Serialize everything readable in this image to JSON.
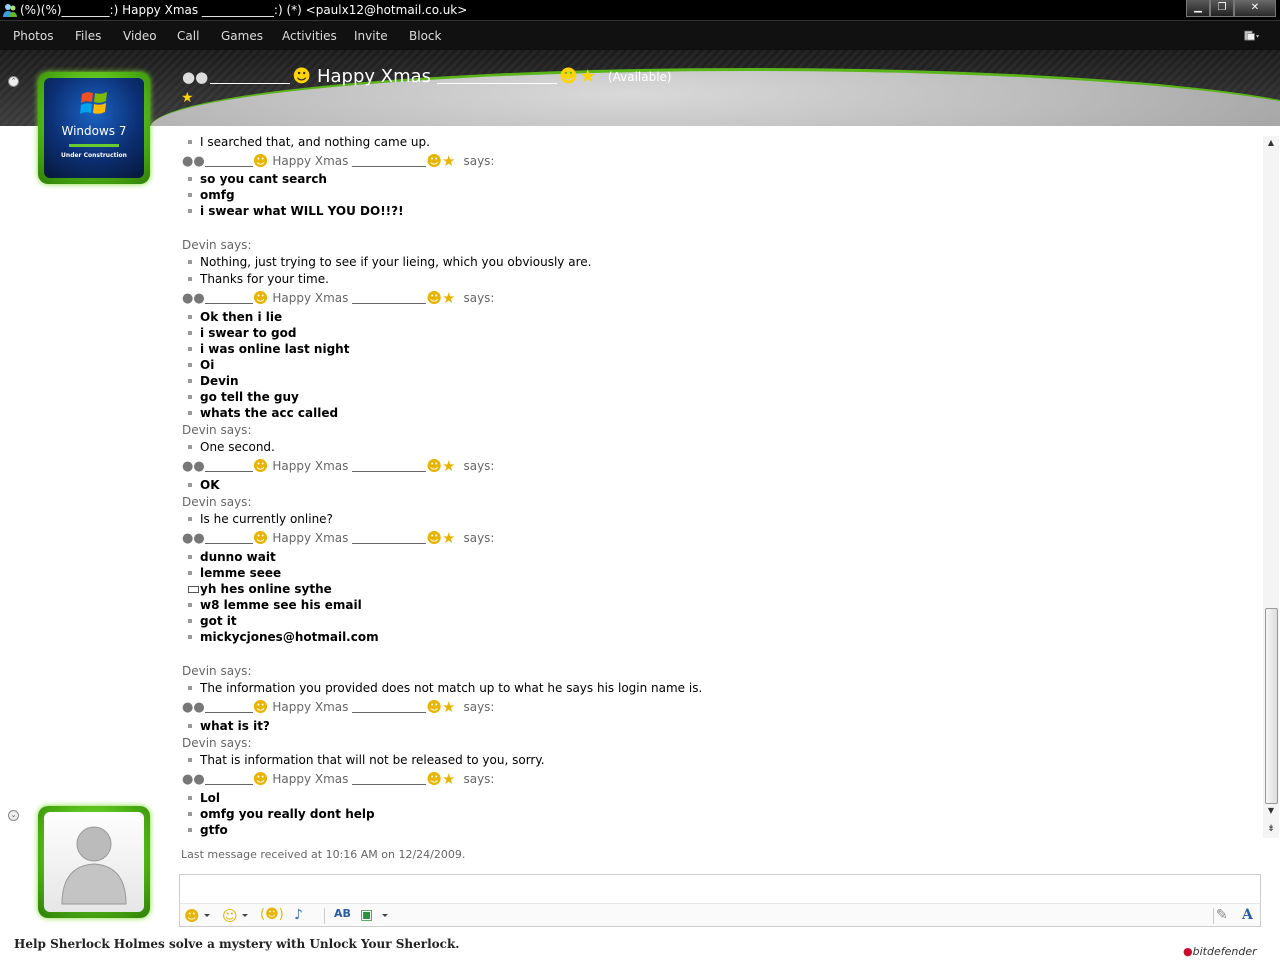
{
  "window": {
    "title": "(%)(%)________:) Happy Xmas ____________:) (*) <paulx12@hotmail.co.uk>",
    "buttons": [
      "minimize",
      "maximize",
      "close"
    ]
  },
  "menu": {
    "items": [
      "Photos",
      "Files",
      "Video",
      "Call",
      "Games",
      "Activities",
      "Invite",
      "Block"
    ]
  },
  "header": {
    "contact_name": "Happy Xmas",
    "status": "(Available)"
  },
  "my_avatar": {
    "label": "Windows 7",
    "sublabel": "Under Construction"
  },
  "conversation": {
    "lines": [
      {
        "type": "item",
        "style": "plain",
        "text": "I searched that, and nothing came up."
      },
      {
        "type": "says",
        "name": "Happy Xmas",
        "suffix": "says:"
      },
      {
        "type": "item",
        "style": "bold",
        "text": "so you cant search"
      },
      {
        "type": "item",
        "style": "bold",
        "text": "omfg"
      },
      {
        "type": "item",
        "style": "bold",
        "text": "i swear what WILL YOU DO!!?!"
      },
      {
        "type": "sender",
        "text": "Devin says:"
      },
      {
        "type": "item",
        "style": "plain",
        "text": "Nothing, just trying to see if your lieing, which you obviously are."
      },
      {
        "type": "item",
        "style": "plain",
        "text": "Thanks for your time."
      },
      {
        "type": "says",
        "name": "Happy Xmas",
        "suffix": "says:"
      },
      {
        "type": "item",
        "style": "bold",
        "text": "Ok then i lie"
      },
      {
        "type": "item",
        "style": "bold",
        "text": "i swear to god"
      },
      {
        "type": "item",
        "style": "bold",
        "text": "i was online last night"
      },
      {
        "type": "item",
        "style": "bold",
        "text": "Oi"
      },
      {
        "type": "item",
        "style": "bold",
        "text": "Devin"
      },
      {
        "type": "item",
        "style": "bold",
        "text": "go tell the guy"
      },
      {
        "type": "item",
        "style": "bold",
        "text": "whats the acc called"
      },
      {
        "type": "sender",
        "text": "Devin says:"
      },
      {
        "type": "item",
        "style": "plain",
        "text": "One second."
      },
      {
        "type": "says",
        "name": "Happy Xmas",
        "suffix": "says:"
      },
      {
        "type": "item",
        "style": "bold",
        "text": "OK"
      },
      {
        "type": "sender",
        "text": "Devin says:"
      },
      {
        "type": "item",
        "style": "plain",
        "text": "Is he currently online?"
      },
      {
        "type": "says",
        "name": "Happy Xmas",
        "suffix": "says:"
      },
      {
        "type": "item",
        "style": "bold",
        "text": "dunno wait"
      },
      {
        "type": "item",
        "style": "bold",
        "text": "lemme seee"
      },
      {
        "type": "item-box",
        "style": "bold",
        "text": "yh hes online sythe"
      },
      {
        "type": "item",
        "style": "bold",
        "text": "w8 lemme see his email"
      },
      {
        "type": "item",
        "style": "bold",
        "text": "got it"
      },
      {
        "type": "item",
        "style": "bold",
        "text": "mickycjones@hotmail.com"
      },
      {
        "type": "sender",
        "text": "Devin says:"
      },
      {
        "type": "item",
        "style": "plain",
        "text": "The information you provided does not match up to what he says his login name is."
      },
      {
        "type": "says",
        "name": "Happy Xmas",
        "suffix": "says:"
      },
      {
        "type": "item",
        "style": "bold",
        "text": "what is it?"
      },
      {
        "type": "sender",
        "text": "Devin says:"
      },
      {
        "type": "item",
        "style": "plain",
        "text": "That is information that will not be released to you, sorry."
      },
      {
        "type": "says",
        "name": "Happy Xmas",
        "suffix": "says:"
      },
      {
        "type": "item",
        "style": "bold",
        "text": "Lol"
      },
      {
        "type": "item",
        "style": "bold",
        "text": "omfg you really dont help"
      },
      {
        "type": "item",
        "style": "bold",
        "text": "gtfo"
      }
    ],
    "last_message": "Last message received at 10:16 AM on 12/24/2009."
  },
  "input": {
    "value": ""
  },
  "toolbar_icons": [
    "emoticon-icon",
    "wink-icon",
    "nudge-icon",
    "voice-clip-icon",
    "font-icon",
    "background-icon",
    "handwriting-icon",
    "text-icon"
  ],
  "footer": {
    "ad_text": "Help Sherlock Holmes solve a mystery with Unlock Your Sherlock.",
    "brand_prefix": "bit",
    "brand_suffix": "defender"
  },
  "colors": {
    "accent_green": "#5ab51b",
    "sender_gray": "#666666"
  }
}
